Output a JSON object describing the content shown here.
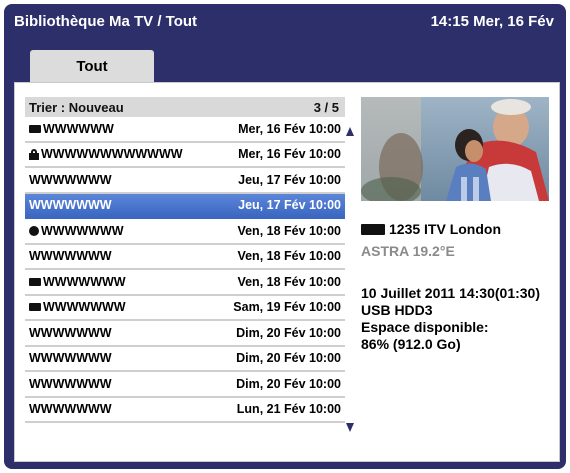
{
  "header": {
    "title": "Bibliothèque Ma TV / Tout",
    "clock": "14:15 Mer, 16 Fév"
  },
  "tabs": [
    {
      "label": "Tout"
    }
  ],
  "list": {
    "sort_label": "Trier : Nouveau",
    "page": "3 / 5",
    "rows": [
      {
        "name": "WWWWWW",
        "date": "Mer, 16 Fév 10:00",
        "icon": "record-icon"
      },
      {
        "name": "WWWWWWWWWWWW",
        "date": "Mer, 16 Fév 10:00",
        "icon": "lock-icon"
      },
      {
        "name": "WWWWWWW",
        "date": "Jeu, 17 Fév 10:00",
        "icon": ""
      },
      {
        "name": "WWWWWWW",
        "date": "Jeu, 17 Fév 10:00",
        "icon": "",
        "selected": true
      },
      {
        "name": "WWWWWWW",
        "date": "Ven, 18 Fév 10:00",
        "icon": "dot-icon"
      },
      {
        "name": "WWWWWWW",
        "date": "Ven, 18 Fév 10:00",
        "icon": ""
      },
      {
        "name": "WWWWWWW",
        "date": "Ven, 18 Fév 10:00",
        "icon": "record-icon"
      },
      {
        "name": "WWWWWWW",
        "date": "Sam, 19 Fév 10:00",
        "icon": "record-icon"
      },
      {
        "name": "WWWWWWW",
        "date": "Dim, 20 Fév 10:00",
        "icon": ""
      },
      {
        "name": "WWWWWWW",
        "date": "Dim, 20 Fév 10:00",
        "icon": ""
      },
      {
        "name": "WWWWWWW",
        "date": "Dim, 20 Fév 10:00",
        "icon": ""
      },
      {
        "name": "WWWWWWW",
        "date": "Lun, 21 Fév 10:00",
        "icon": ""
      }
    ]
  },
  "details": {
    "channel": "1235 ITV London",
    "satellite": "ASTRA 19.2°E",
    "datetime": "10 Juillet 2011  14:30(01:30)",
    "storage": "USB HDD3",
    "space_label": "Espace disponible:",
    "space_value": "86% (912.0 Go)"
  },
  "colors": {
    "frame": "#2d2f6b",
    "selected_row": "#4a76cc"
  }
}
